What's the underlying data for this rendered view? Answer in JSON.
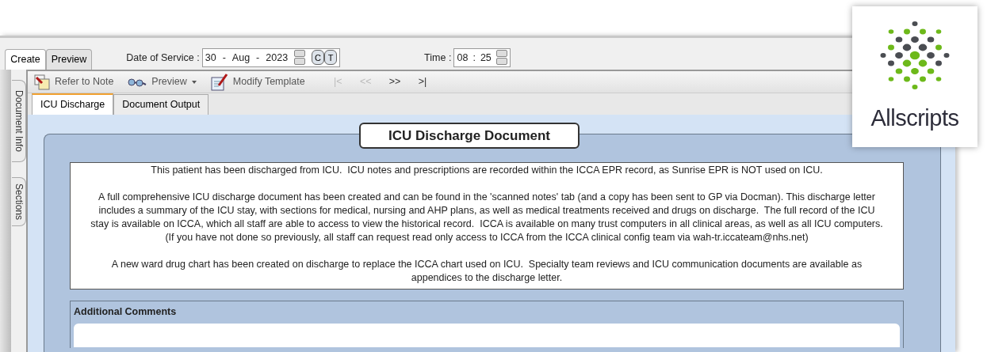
{
  "window_tabs": [
    {
      "label": "Create",
      "selected": true
    },
    {
      "label": "Preview",
      "selected": false
    }
  ],
  "date_of_service": {
    "label": "Date of Service :",
    "day": "30",
    "separator_1": "-",
    "month": "Aug",
    "separator_2": "-",
    "year": "2023",
    "buttons": [
      "C",
      "T"
    ]
  },
  "time": {
    "label": "Time :",
    "hour": "08",
    "separator": ":",
    "minute": "25"
  },
  "side_tabs": [
    {
      "label": "Document Info"
    },
    {
      "label": "Sections"
    }
  ],
  "toolbar": [
    {
      "kind": "refer",
      "label": "Refer to Note"
    },
    {
      "kind": "preview",
      "label": "Preview"
    },
    {
      "kind": "modify",
      "label": "Modify Template"
    }
  ],
  "navigation": [
    {
      "label": "|<",
      "disabled": true
    },
    {
      "label": "<<",
      "disabled": true
    },
    {
      "label": ">>",
      "disabled": false
    },
    {
      "label": ">|",
      "disabled": false
    }
  ],
  "document_tabs": [
    {
      "label": "ICU Discharge",
      "selected": true
    },
    {
      "label": "Document Output",
      "selected": false
    }
  ],
  "form": {
    "title": "ICU Discharge Document",
    "paragraphs": [
      [
        "This patient has been discharged from ICU.  ICU notes and prescriptions are recorded within the ICCA EPR record, as Sunrise EPR is NOT used on ICU."
      ],
      [
        "A full comprehensive ICU discharge document has been created and can be found in the 'scanned notes' tab (and a copy has been sent to GP via Docman). This discharge letter",
        "includes a summary of the ICU stay, with sections for medical, nursing and AHP plans, as well as medical treatments received and drugs on discharge.  The full record of the ICU",
        "stay is available on ICCA, which all staff are able to access to view the historical record.  ICCA is available on many trust computers in all clinical areas, as well as all ICU computers.",
        "(If you have not done so previously, all staff can request read only access to ICCA from the ICCA clinical config team via wah-tr.iccateam@nhs.net)"
      ],
      [
        "A new ward drug chart has been created on discharge to replace the ICCA chart used on ICU.  Specialty team reviews and ICU communication documents are available as",
        "appendices to the discharge letter."
      ]
    ],
    "additional_comments": {
      "label": "Additional Comments"
    }
  },
  "logo": {
    "text": "Allscripts"
  }
}
